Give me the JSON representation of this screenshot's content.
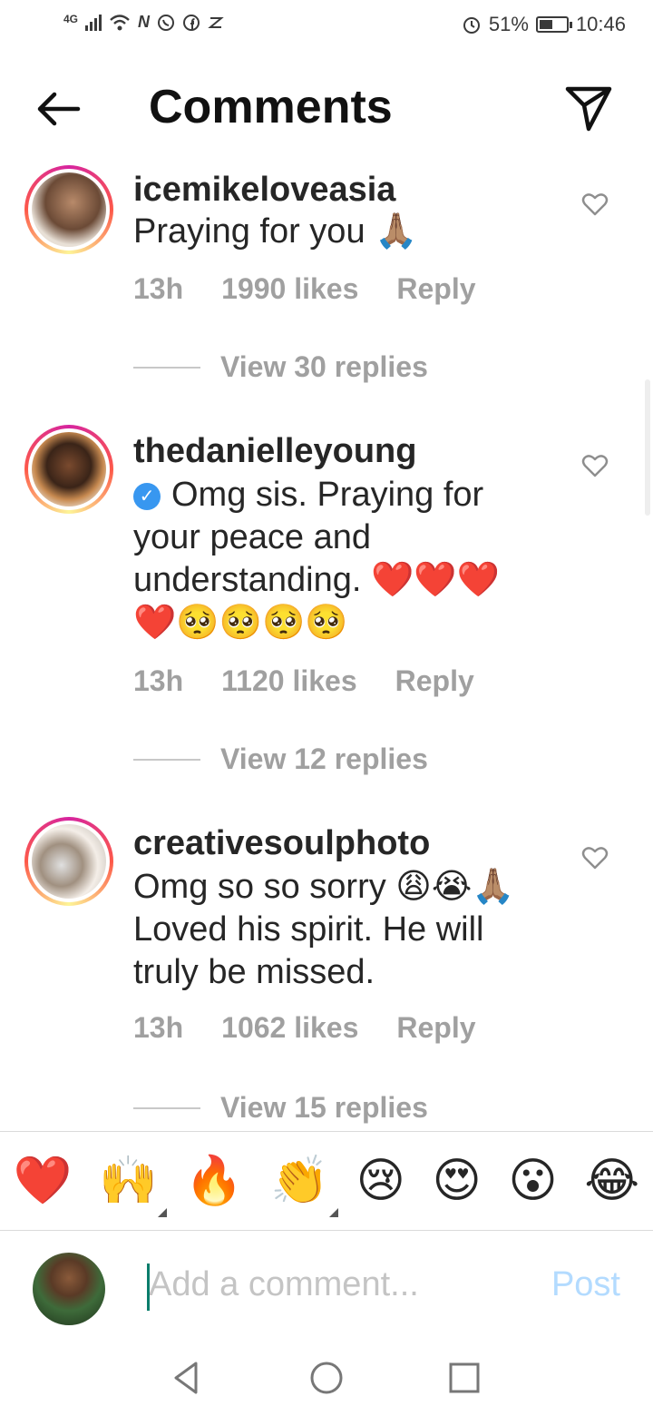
{
  "status_bar": {
    "network": "4G",
    "battery": "51%",
    "battery_level": 0.51,
    "time": "10:46",
    "icons": [
      "signal-icon",
      "wifi-icon",
      "n-icon",
      "whatsapp-icon",
      "facebook-icon",
      "app-icon",
      "alarm-icon",
      "battery-icon"
    ]
  },
  "header": {
    "title": "Comments",
    "back_icon": "arrow-left-icon",
    "send_icon": "paper-plane-icon"
  },
  "comments": [
    {
      "username": "icemikeloveasia",
      "verified": false,
      "text": "Praying for you 🙏🏽",
      "time": "13h",
      "likes": "1990 likes",
      "reply": "Reply",
      "view_replies": "View 30 replies"
    },
    {
      "username": "thedanielleyoung",
      "verified": true,
      "text": "Omg sis. Praying for your peace and understanding. ❤️❤️❤️❤️🥺🥺🥺🥺",
      "time": "13h",
      "likes": "1120 likes",
      "reply": "Reply",
      "view_replies": "View 12 replies"
    },
    {
      "username": "creativesoulphoto",
      "verified": false,
      "text": "Omg so so sorry 😩😭🙏🏽 Loved his  spirit. He will truly be missed.",
      "time": "13h",
      "likes": "1062 likes",
      "reply": "Reply",
      "view_replies": "View 15 replies"
    }
  ],
  "emoji_bar": [
    "❤️",
    "🙌",
    "🔥",
    "👏",
    "😢",
    "😍",
    "😮",
    "😂"
  ],
  "input": {
    "placeholder": "Add a comment...",
    "post_label": "Post"
  },
  "nav_icons": [
    "back-triangle-icon",
    "home-circle-icon",
    "recents-square-icon"
  ]
}
